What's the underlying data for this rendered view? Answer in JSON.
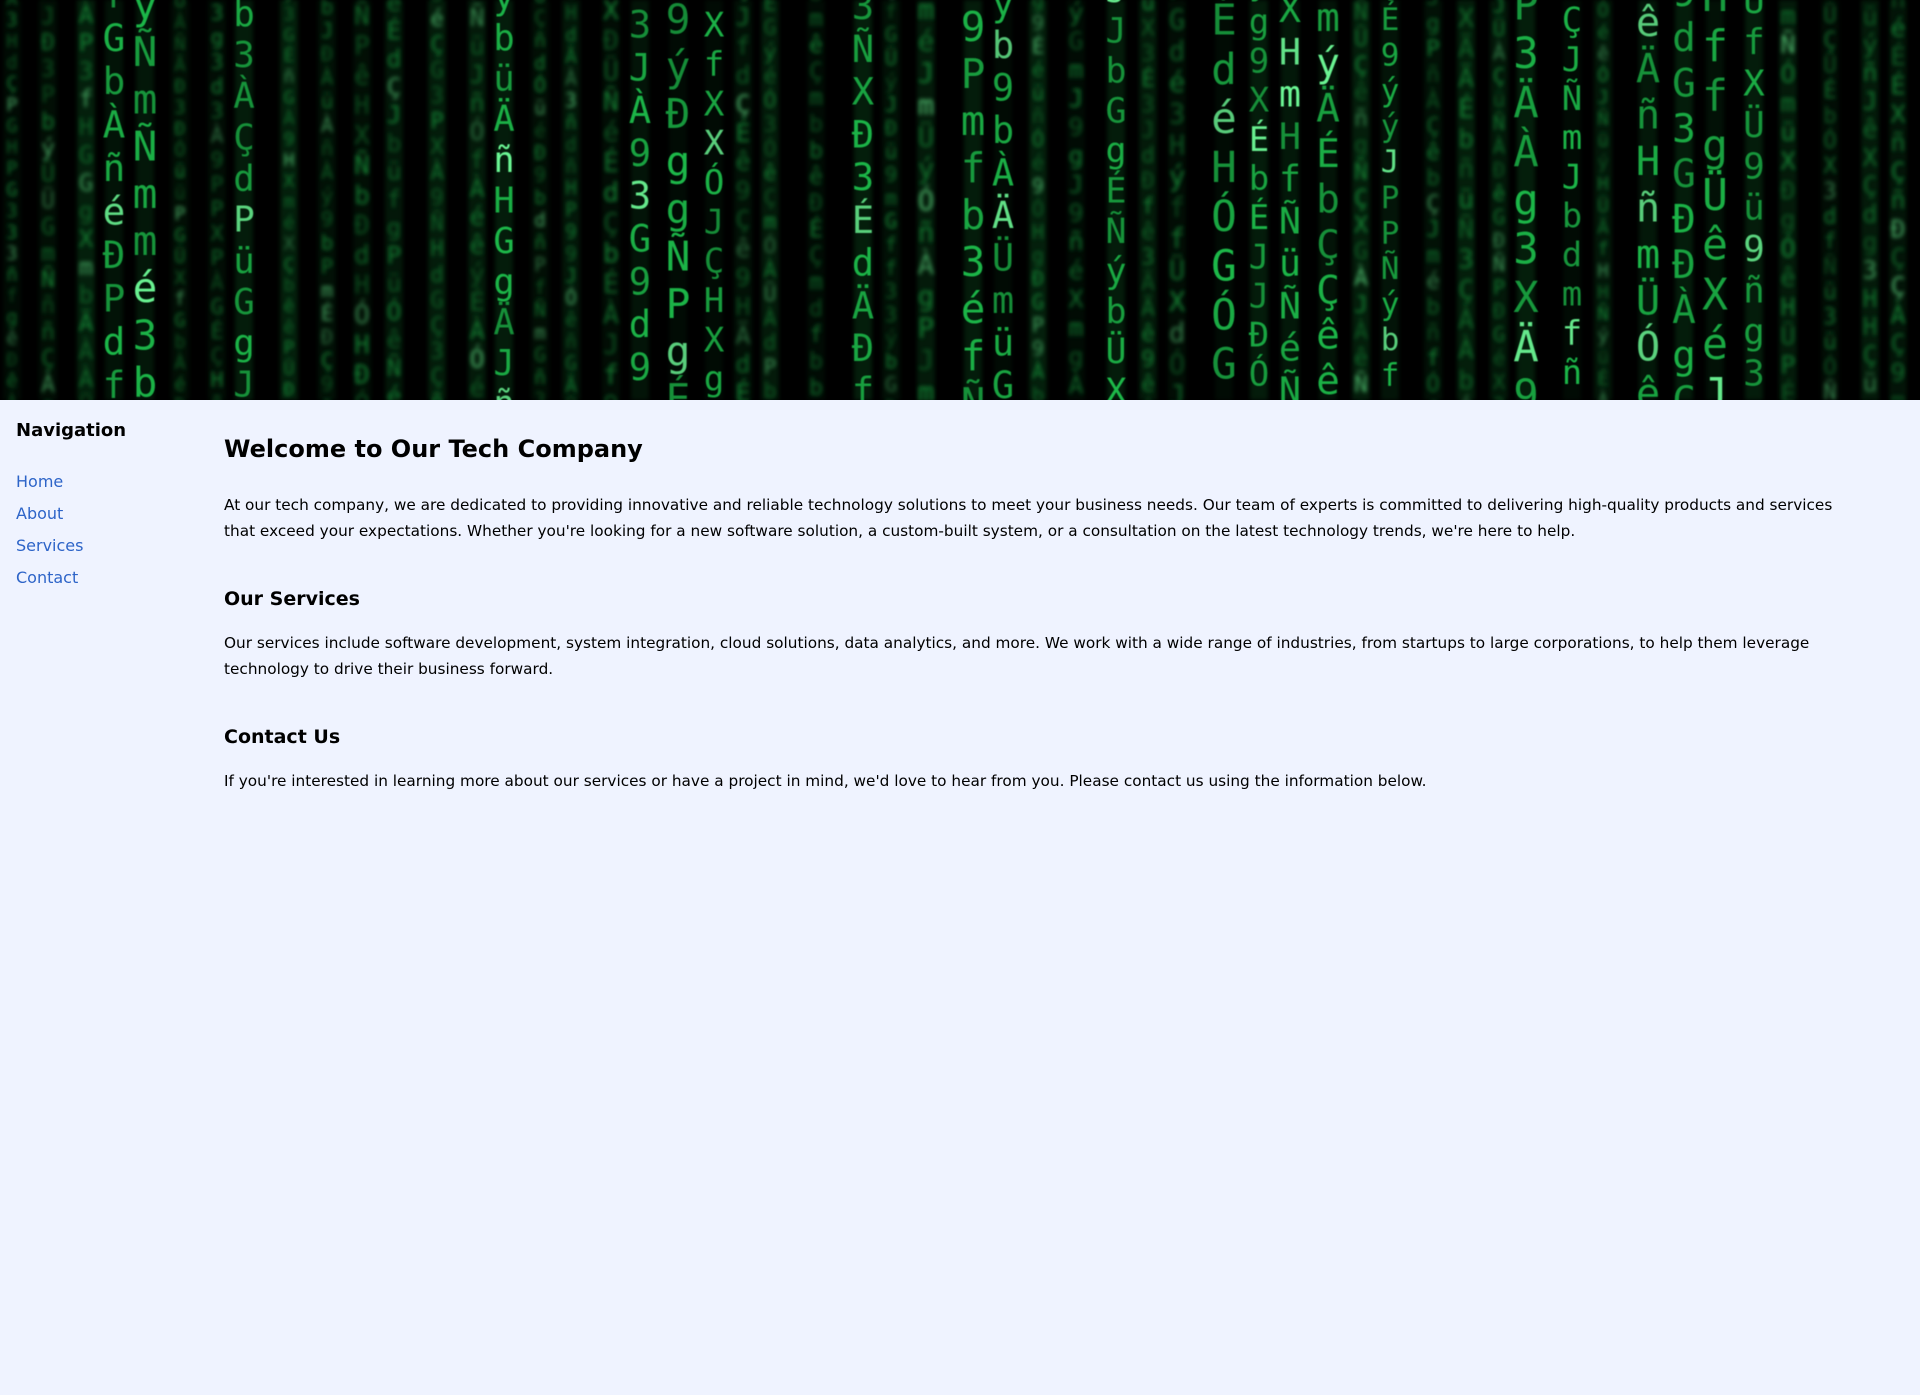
{
  "hero": {
    "image": "matrix-green-code-banner",
    "colors": {
      "background": "#000000",
      "glyph": "#1fb84a",
      "glyph_bright": "#6fff9a"
    },
    "glyphs": [
      "G",
      "Ü",
      "Ð",
      "f",
      "J",
      "H",
      "d",
      "X",
      "b",
      "m",
      "Ó",
      "3",
      "À",
      "Ñ",
      "Ä",
      "ý",
      "g",
      "É",
      "P",
      "9",
      "ê",
      "ü",
      "ñ",
      "é",
      "Ç"
    ]
  },
  "sidebar": {
    "title": "Navigation",
    "items": [
      {
        "label": "Home"
      },
      {
        "label": "About"
      },
      {
        "label": "Services"
      },
      {
        "label": "Contact"
      }
    ]
  },
  "main": {
    "title": "Welcome to Our Tech Company",
    "intro": "At our tech company, we are dedicated to providing innovative and reliable technology solutions to meet your business needs. Our team of experts is committed to delivering high-quality products and services that exceed your expectations. Whether you're looking for a new software solution, a custom-built system, or a consultation on the latest technology trends, we're here to help.",
    "services_heading": "Our Services",
    "services_text": "Our services include software development, system integration, cloud solutions, data analytics, and more. We work with a wide range of industries, from startups to large corporations, to help them leverage technology to drive their business forward.",
    "contact_heading": "Contact Us",
    "contact_text": "If you're interested in learning more about our services or have a project in mind, we'd love to hear from you. Please contact us using the information below."
  },
  "colors": {
    "page_background": "#eff3ff",
    "link": "#2d64c8",
    "text": "#000000"
  }
}
